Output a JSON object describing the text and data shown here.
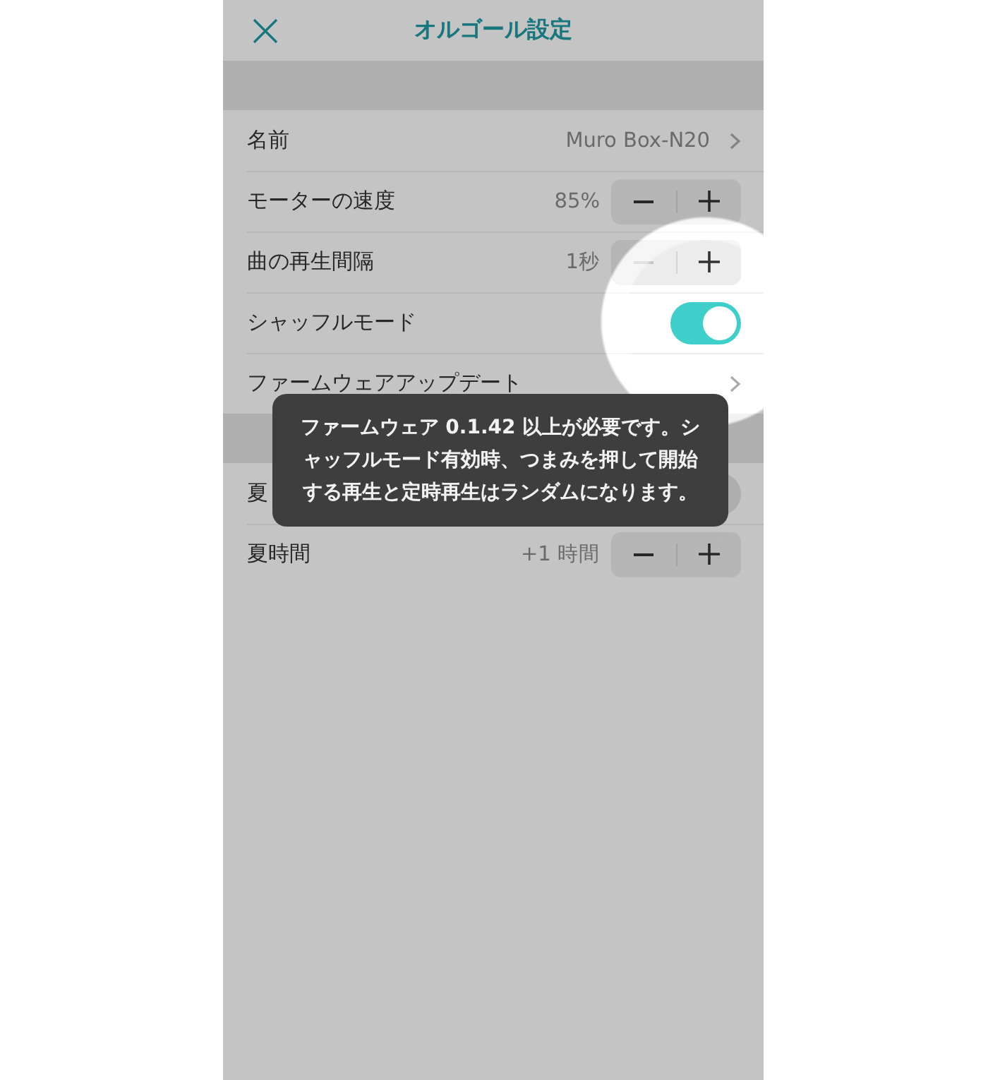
{
  "header": {
    "title": "オルゴール設定"
  },
  "sections": [
    {
      "rows": [
        {
          "kind": "link",
          "label": "名前",
          "value": "Muro Box-N20"
        },
        {
          "kind": "stepper",
          "label": "モーターの速度",
          "value": "85%",
          "minus_disabled": false
        },
        {
          "kind": "stepper",
          "label": "曲の再生間隔",
          "value": "1秒",
          "minus_disabled": true
        },
        {
          "kind": "toggle",
          "label": "シャッフルモード",
          "on": true
        },
        {
          "kind": "link",
          "label": "ファームウェアアップデート"
        }
      ]
    },
    {
      "rows": [
        {
          "kind": "toggle",
          "label": "夏",
          "on": false
        },
        {
          "kind": "stepper",
          "label": "夏時間",
          "value": "+1 時間",
          "minus_disabled": false
        }
      ]
    }
  ],
  "tooltip": {
    "text": "ファームウェア 0.1.42 以上が必要です。シャッフルモード有効時、つまみを押して開始する再生と定時再生はランダムになります。"
  }
}
